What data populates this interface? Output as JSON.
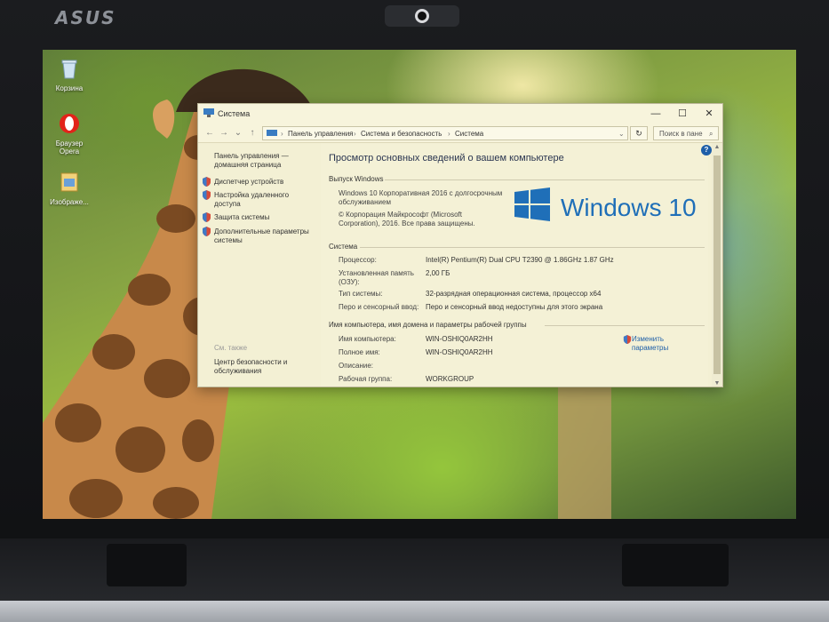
{
  "laptop": {
    "brand": "ASUS"
  },
  "desktop": {
    "icons": [
      {
        "label": "Корзина",
        "icon": "recycle-bin-icon"
      },
      {
        "label": "Браузер Opera",
        "icon": "opera-icon"
      },
      {
        "label": "Изображе...",
        "icon": "image-file-icon"
      }
    ]
  },
  "window": {
    "title": "Система",
    "controls": {
      "minimize": "—",
      "maximize": "☐",
      "close": "✕"
    },
    "address": {
      "crumbs": [
        "Панель управления",
        "Система и безопасность",
        "Система"
      ],
      "search_placeholder": "Поиск в пане"
    },
    "left_pane": {
      "home_link": "Панель управления — домашняя страница",
      "links": [
        "Диспетчер устройств",
        "Настройка удаленного доступа",
        "Защита системы",
        "Дополнительные параметры системы"
      ],
      "see_also": "См. также",
      "see_also_link": "Центр безопасности и обслуживания"
    },
    "main": {
      "heading": "Просмотр основных сведений о вашем компьютере",
      "edition_section": "Выпуск Windows",
      "edition": "Windows 10 Корпоративная 2016 с долгосрочным обслуживанием",
      "copyright": "© Корпорация Майкрософт (Microsoft Corporation), 2016. Все права защищены.",
      "logo_text": "Windows 10",
      "system_section": "Система",
      "system": [
        {
          "label": "Процессор:",
          "value": "Intel(R) Pentium(R) Dual  CPU  T2390  @ 1.86GHz   1.87 GHz"
        },
        {
          "label": "Установленная память (ОЗУ):",
          "value": "2,00 ГБ"
        },
        {
          "label": "Тип системы:",
          "value": "32-разрядная операционная система, процессор x64"
        },
        {
          "label": "Перо и сенсорный ввод:",
          "value": "Перо и сенсорный ввод недоступны для этого экрана"
        }
      ],
      "computer_section": "Имя компьютера, имя домена и параметры рабочей группы",
      "computer": [
        {
          "label": "Имя компьютера:",
          "value": "WIN-OSHIQ0AR2HH"
        },
        {
          "label": "Полное имя:",
          "value": "WIN-OSHIQ0AR2HH"
        },
        {
          "label": "Описание:",
          "value": ""
        },
        {
          "label": "Рабочая группа:",
          "value": "WORKGROUP"
        }
      ],
      "change_params": "Изменить параметры"
    }
  },
  "colors": {
    "accent": "#1f6fb8",
    "window_bg": "#f3f0d4",
    "link": "#1e5fa8"
  }
}
